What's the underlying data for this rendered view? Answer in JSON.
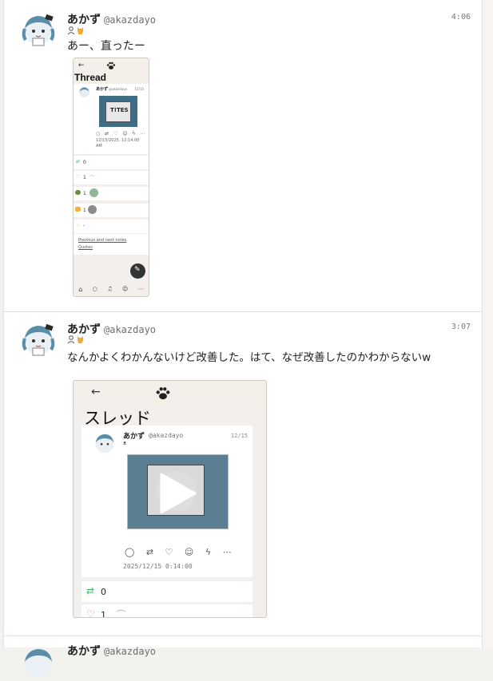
{
  "colors": {
    "accent_green": "#3fbf5f",
    "heart_pink": "#e37aa0",
    "text_muted": "#6e6e6e"
  },
  "notes": [
    {
      "author": "あかず",
      "handle": "@akazdayo",
      "time": "4:06",
      "text": "あー、直ったー",
      "badges": [
        "person-icon",
        "cat-icon"
      ],
      "attachment": {
        "nav_icon": "paw-icon",
        "title": "Thread",
        "inner_author": "あかず",
        "inner_handle": "@akazdayo",
        "inner_time": "12/15",
        "image_text": "T!TES",
        "inner_timestamp": "12/15/2025, 12:14:00 AM",
        "stats": [
          {
            "icon": "renote-icon",
            "value": "0"
          },
          {
            "icon": "heart-icon",
            "value": "1"
          },
          {
            "icon": "turtle-emoji",
            "value": "1"
          },
          {
            "icon": "thumbs-up-emoji",
            "value": "1"
          },
          {
            "icon": "star-icon",
            "value": "-"
          }
        ],
        "links": [
          "Previous and next notes",
          "Quotes"
        ]
      }
    },
    {
      "author": "あかず",
      "handle": "@akazdayo",
      "time": "3:07",
      "text": "なんかよくわかんないけど改善した。はて、なぜ改善したのかわからないw",
      "badges": [
        "person-icon",
        "cat-icon"
      ],
      "attachment": {
        "nav_icon": "paw-icon",
        "title": "スレッド",
        "inner_author": "あかず",
        "inner_handle": "@akazdayo",
        "inner_time": "12/15",
        "inner_timestamp": "2025/12/15 0:14:00",
        "stats": [
          {
            "icon": "renote-icon",
            "value": "0"
          },
          {
            "icon": "heart-icon",
            "value": "1"
          }
        ]
      }
    },
    {
      "author": "あかず",
      "handle": "@akazdayo"
    }
  ]
}
